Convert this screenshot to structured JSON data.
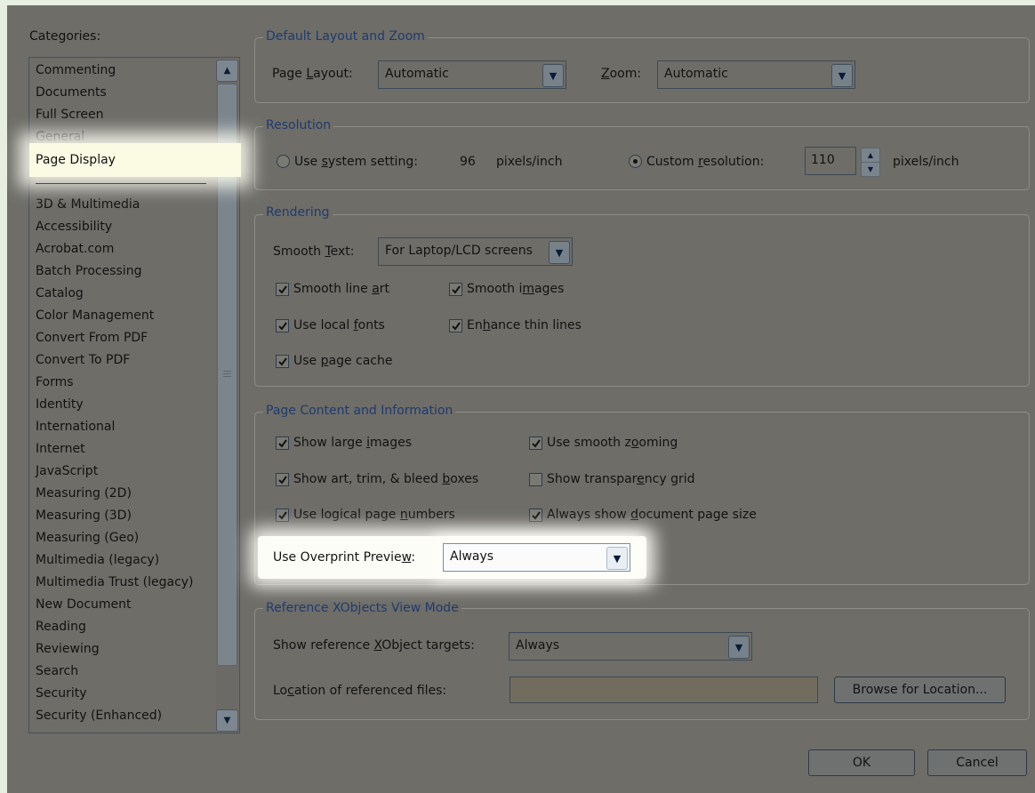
{
  "categories": {
    "header": "Categories:",
    "top_items": [
      "Commenting",
      "Documents",
      "Full Screen",
      "General",
      "Page Display"
    ],
    "selected": "Page Display",
    "items": [
      "3D & Multimedia",
      "Accessibility",
      "Acrobat.com",
      "Batch Processing",
      "Catalog",
      "Color Management",
      "Convert From PDF",
      "Convert To PDF",
      "Forms",
      "Identity",
      "International",
      "Internet",
      "JavaScript",
      "Measuring (2D)",
      "Measuring (3D)",
      "Measuring (Geo)",
      "Multimedia (legacy)",
      "Multimedia Trust (legacy)",
      "New Document",
      "Reading",
      "Reviewing",
      "Search",
      "Security",
      "Security (Enhanced)"
    ]
  },
  "layout_zoom": {
    "title": "Default Layout and Zoom",
    "page_layout_label": "Page Layout:",
    "page_layout_value": "Automatic",
    "zoom_label": "Zoom:",
    "zoom_value": "Automatic"
  },
  "resolution": {
    "title": "Resolution",
    "system_label": "Use system setting:",
    "system_value": "96",
    "system_unit": "pixels/inch",
    "custom_label": "Custom resolution:",
    "custom_value": "110",
    "custom_unit": "pixels/inch",
    "selected": "custom"
  },
  "rendering": {
    "title": "Rendering",
    "smooth_text_label": "Smooth Text:",
    "smooth_text_value": "For Laptop/LCD screens",
    "smooth_line_art": "Smooth line art",
    "smooth_images": "Smooth images",
    "use_local_fonts": "Use local fonts",
    "enhance_thin_lines": "Enhance thin lines",
    "use_page_cache": "Use page cache"
  },
  "page_content": {
    "title": "Page Content and Information",
    "show_large_images": "Show large images",
    "use_smooth_zooming": "Use smooth zooming",
    "show_art_trim": "Show art, trim, & bleed boxes",
    "show_transparency_grid": "Show transparency grid",
    "use_logical_page_numbers": "Use logical page numbers",
    "always_show_page_size": "Always show document page size",
    "overprint_label": "Use Overprint Preview:",
    "overprint_value": "Always"
  },
  "xobjects": {
    "title": "Reference XObjects View Mode",
    "targets_label": "Show reference XObject targets:",
    "targets_value": "Always",
    "location_label": "Location of referenced files:",
    "location_value": "",
    "browse_label": "Browse for Location..."
  },
  "buttons": {
    "ok": "OK",
    "cancel": "Cancel"
  },
  "checkbox_states": {
    "smooth_line_art": true,
    "smooth_images": true,
    "use_local_fonts": true,
    "enhance_thin_lines": true,
    "use_page_cache": true,
    "show_large_images": true,
    "use_smooth_zooming": true,
    "show_art_trim": true,
    "show_transparency_grid": false,
    "use_logical_page_numbers": true,
    "always_show_page_size": true
  }
}
